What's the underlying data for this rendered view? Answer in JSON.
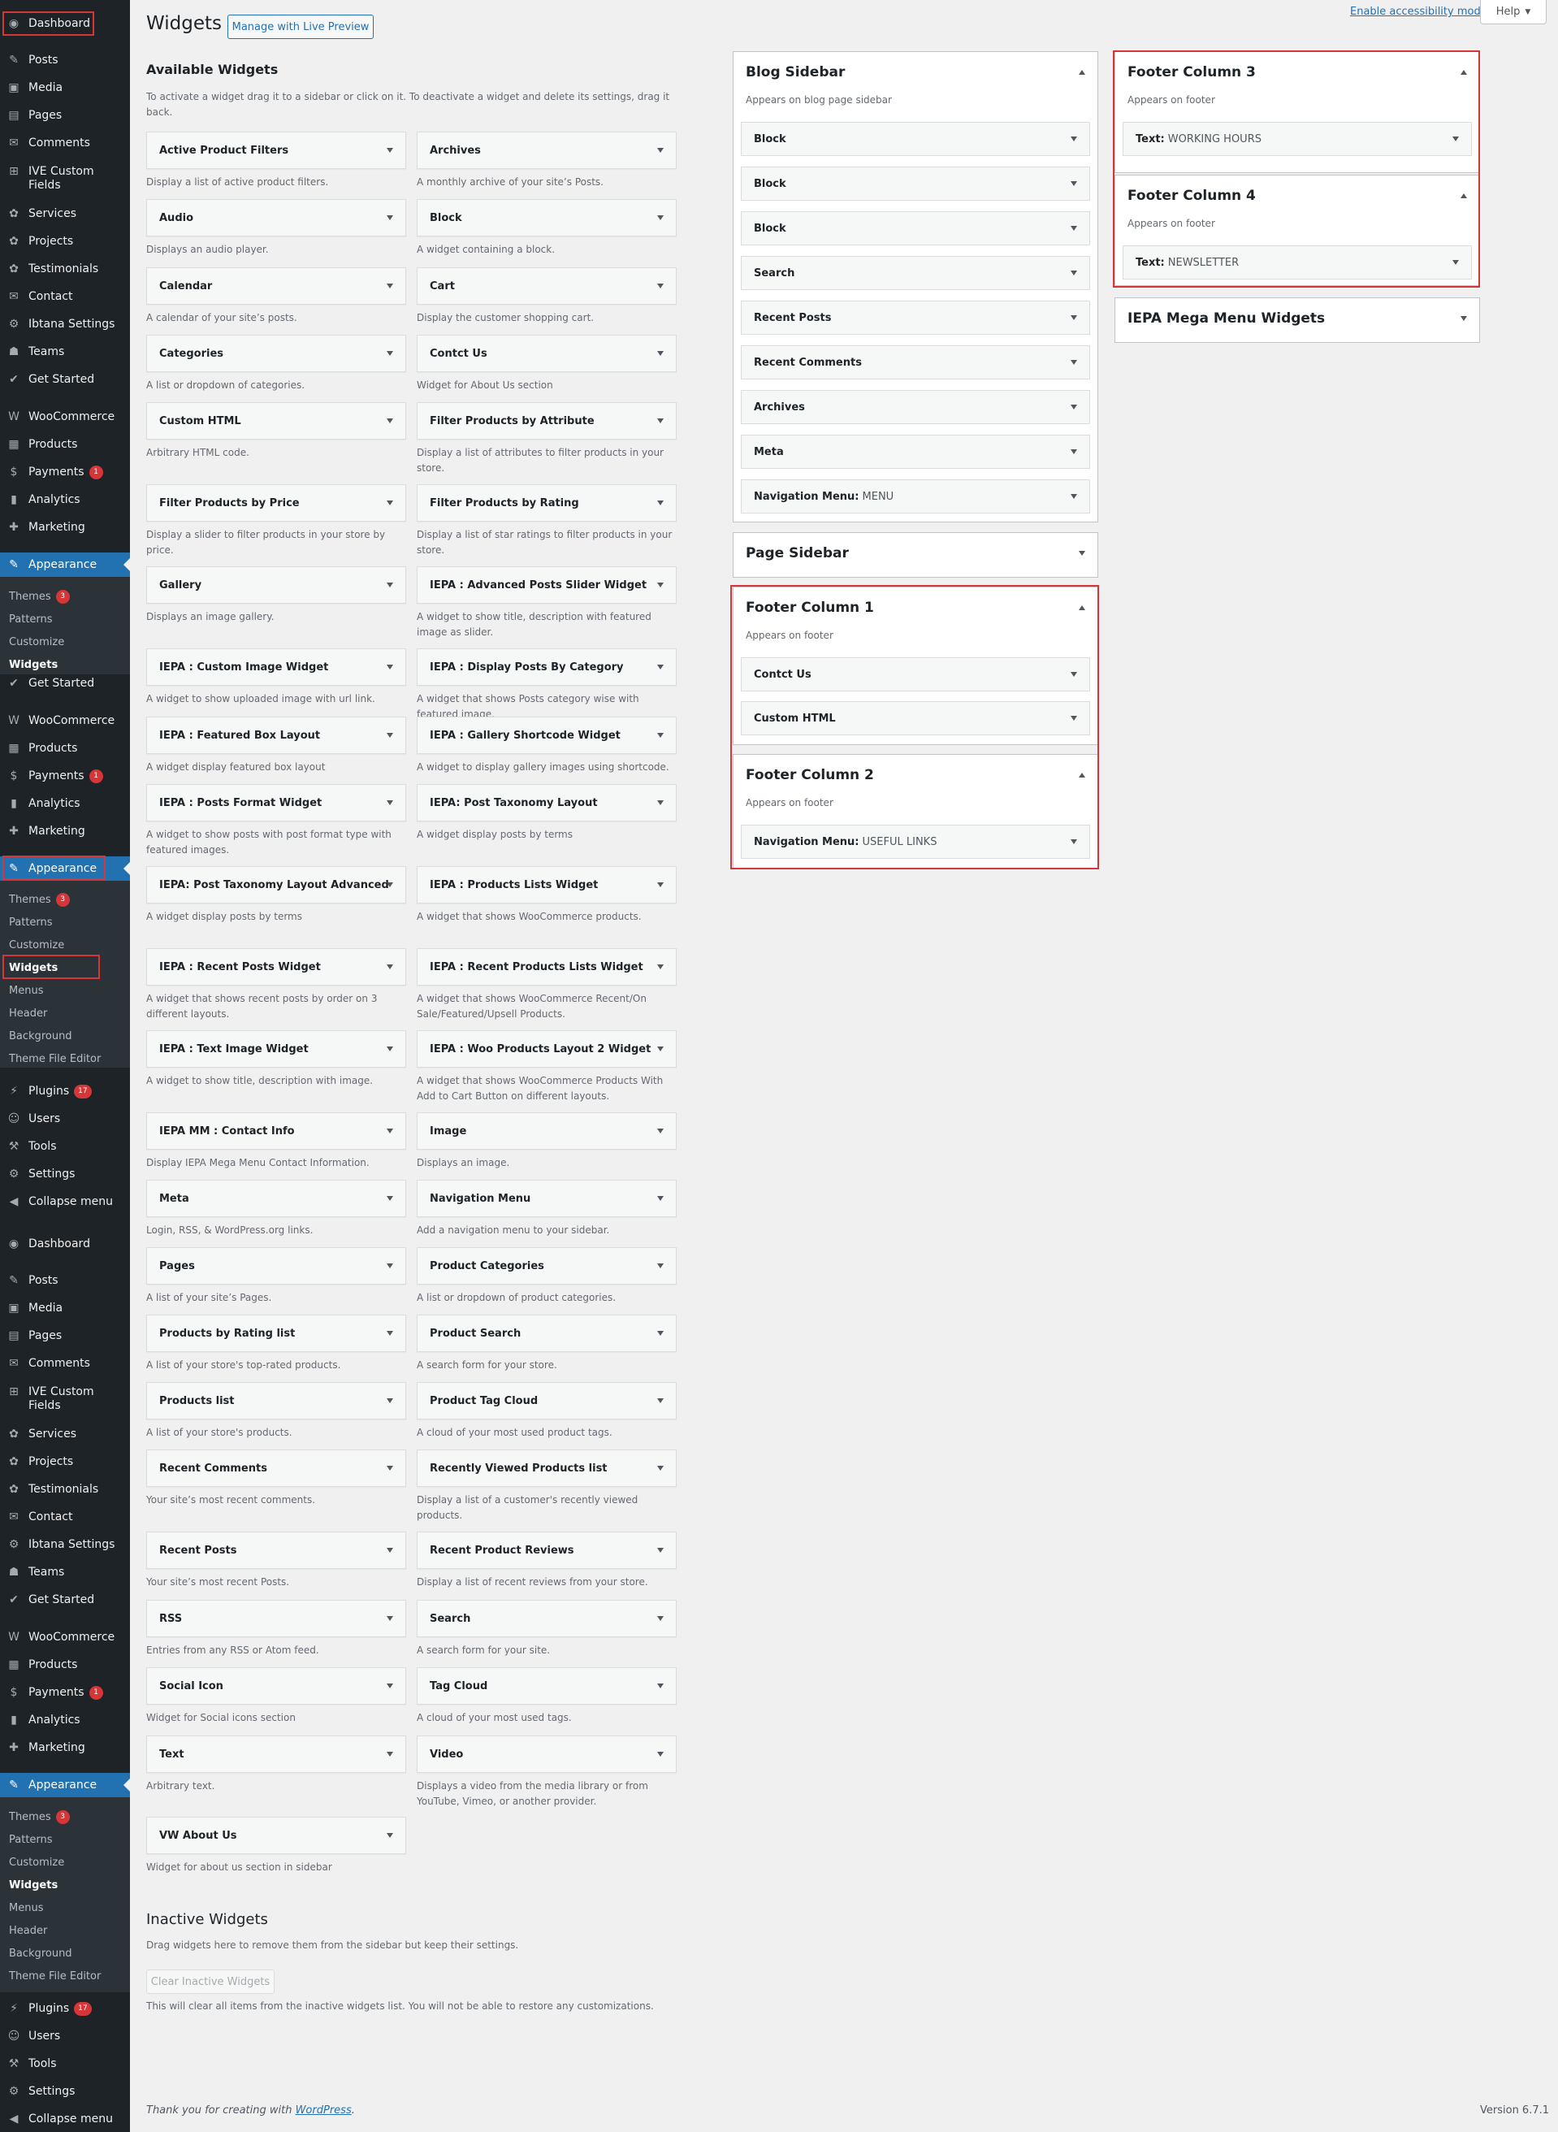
{
  "sidebar_blocks": [
    {
      "items": [
        "Dashboard",
        "Posts",
        "Media",
        "Pages",
        "Comments",
        "IVE Custom Fields",
        "Services",
        "Projects",
        "Testimonials",
        "Contact",
        "Ibtana Settings",
        "Teams",
        "Get Started",
        "WooCommerce",
        "Products",
        "Payments",
        "Analytics",
        "Marketing",
        "Appearance"
      ]
    },
    {
      "items": [
        "WooCommerce",
        "Products",
        "Payments",
        "Analytics",
        "Marketing",
        "Appearance"
      ]
    },
    {
      "items": [
        "Plugins",
        "Users",
        "Tools",
        "Settings",
        "Collapse menu"
      ]
    }
  ],
  "sidebar": {
    "dashboard": "Dashboard",
    "posts": "Posts",
    "media": "Media",
    "pages": "Pages",
    "comments": "Comments",
    "ive_custom_fields": "IVE Custom Fields",
    "services": "Services",
    "projects": "Projects",
    "testimonials": "Testimonials",
    "contact": "Contact",
    "ibtana_settings": "Ibtana Settings",
    "teams": "Teams",
    "get_started": "Get Started",
    "woocommerce": "WooCommerce",
    "products": "Products",
    "payments": "Payments",
    "payments_badge": "1",
    "analytics": "Analytics",
    "marketing": "Marketing",
    "appearance": "Appearance",
    "themes": "Themes",
    "themes_badge": "3",
    "patterns": "Patterns",
    "customize": "Customize",
    "widgets": "Widgets",
    "menus": "Menus",
    "header": "Header",
    "background": "Background",
    "theme_file_editor": "Theme File Editor",
    "plugins": "Plugins",
    "plugins_badge": "17",
    "users": "Users",
    "tools": "Tools",
    "settings": "Settings",
    "collapse_menu": "Collapse menu"
  },
  "header": {
    "title": "Widgets",
    "live_preview": "Manage with Live Preview",
    "accessibility": "Enable accessibility mode",
    "help": "Help"
  },
  "available": {
    "title": "Available Widgets",
    "description": "To activate a widget drag it to a sidebar or click on it. To deactivate a widget and delete its settings, drag it back.",
    "widgets": [
      {
        "name": "Active Product Filters",
        "desc": "Display a list of active product filters."
      },
      {
        "name": "Archives",
        "desc": "A monthly archive of your site’s Posts."
      },
      {
        "name": "Audio",
        "desc": "Displays an audio player."
      },
      {
        "name": "Block",
        "desc": "A widget containing a block."
      },
      {
        "name": "Calendar",
        "desc": "A calendar of your site’s posts."
      },
      {
        "name": "Cart",
        "desc": "Display the customer shopping cart."
      },
      {
        "name": "Categories",
        "desc": "A list or dropdown of categories."
      },
      {
        "name": "Contct Us",
        "desc": "Widget for About Us section"
      },
      {
        "name": "Custom HTML",
        "desc": "Arbitrary HTML code."
      },
      {
        "name": "Filter Products by Attribute",
        "desc": "Display a list of attributes to filter products in your store."
      },
      {
        "name": "Filter Products by Price",
        "desc": "Display a slider to filter products in your store by price."
      },
      {
        "name": "Filter Products by Rating",
        "desc": "Display a list of star ratings to filter products in your store."
      },
      {
        "name": "Gallery",
        "desc": "Displays an image gallery."
      },
      {
        "name": "IEPA : Advanced Posts Slider Widget",
        "desc": "A widget to show title, description with featured image as slider."
      },
      {
        "name": "IEPA : Custom Image Widget",
        "desc": "A widget to show uploaded image with url link."
      },
      {
        "name": "IEPA : Display Posts By Category",
        "desc": "A widget that shows Posts category wise with featured image."
      },
      {
        "name": "IEPA : Featured Box Layout",
        "desc": "A widget display featured box layout"
      },
      {
        "name": "IEPA : Gallery Shortcode Widget",
        "desc": "A widget to display gallery images using shortcode."
      },
      {
        "name": "IEPA : Posts Format Widget",
        "desc": "A widget to show posts with post format type with featured images."
      },
      {
        "name": "IEPA: Post Taxonomy Layout",
        "desc": "A widget display posts by terms"
      },
      {
        "name": "IEPA: Post Taxonomy Layout Advanced",
        "desc": "A widget display posts by terms"
      },
      {
        "name": "IEPA : Products Lists Widget",
        "desc": "A widget that shows WooCommerce products."
      },
      {
        "name": "IEPA : Recent Posts Widget",
        "desc": "A widget that shows recent posts by order on 3 different layouts."
      },
      {
        "name": "IEPA : Recent Products Lists Widget",
        "desc": "A widget that shows WooCommerce Recent/On Sale/Featured/Upsell Products."
      },
      {
        "name": "IEPA : Text Image Widget",
        "desc": "A widget to show title, description with image."
      },
      {
        "name": "IEPA : Woo Products Layout 2 Widget",
        "desc": "A widget that shows WooCommerce Products With Add to Cart Button on different layouts."
      },
      {
        "name": "IEPA MM : Contact Info",
        "desc": "Display IEPA Mega Menu Contact Information."
      },
      {
        "name": "Image",
        "desc": "Displays an image."
      },
      {
        "name": "Meta",
        "desc": "Login, RSS, & WordPress.org links."
      },
      {
        "name": "Navigation Menu",
        "desc": "Add a navigation menu to your sidebar."
      },
      {
        "name": "Pages",
        "desc": "A list of your site’s Pages."
      },
      {
        "name": "Product Categories",
        "desc": "A list or dropdown of product categories."
      },
      {
        "name": "Products by Rating list",
        "desc": "A list of your store's top-rated products."
      },
      {
        "name": "Product Search",
        "desc": "A search form for your store."
      },
      {
        "name": "Products list",
        "desc": "A list of your store's products."
      },
      {
        "name": "Product Tag Cloud",
        "desc": "A cloud of your most used product tags."
      },
      {
        "name": "Recent Comments",
        "desc": "Your site’s most recent comments."
      },
      {
        "name": "Recently Viewed Products list",
        "desc": "Display a list of a customer's recently viewed products."
      },
      {
        "name": "Recent Posts",
        "desc": "Your site’s most recent Posts."
      },
      {
        "name": "Recent Product Reviews",
        "desc": "Display a list of recent reviews from your store."
      },
      {
        "name": "RSS",
        "desc": "Entries from any RSS or Atom feed."
      },
      {
        "name": "Search",
        "desc": "A search form for your site."
      },
      {
        "name": "Social Icon",
        "desc": "Widget for Social icons section"
      },
      {
        "name": "Tag Cloud",
        "desc": "A cloud of your most used tags."
      },
      {
        "name": "Text",
        "desc": "Arbitrary text."
      },
      {
        "name": "Video",
        "desc": "Displays a video from the media library or from YouTube, Vimeo, or another provider."
      },
      {
        "name": "VW About Us",
        "desc": "Widget for about us section in sidebar"
      }
    ]
  },
  "inactive": {
    "title": "Inactive Widgets",
    "description": "Drag widgets here to remove them from the sidebar but keep their settings.",
    "clear_button": "Clear Inactive Widgets",
    "note": "This will clear all items from the inactive widgets list. You will not be able to restore any customizations."
  },
  "sidebars": {
    "blog": {
      "title": "Blog Sidebar",
      "desc": "Appears on blog page sidebar",
      "widgets": [
        {
          "name": "Block",
          "sub": ""
        },
        {
          "name": "Block",
          "sub": ""
        },
        {
          "name": "Block",
          "sub": ""
        },
        {
          "name": "Search",
          "sub": ""
        },
        {
          "name": "Recent Posts",
          "sub": ""
        },
        {
          "name": "Recent Comments",
          "sub": ""
        },
        {
          "name": "Archives",
          "sub": ""
        },
        {
          "name": "Meta",
          "sub": ""
        },
        {
          "name": "Navigation Menu:",
          "sub": "MENU"
        }
      ]
    },
    "page": {
      "title": "Page Sidebar"
    },
    "footer1": {
      "title": "Footer Column 1",
      "desc": "Appears on footer",
      "widgets": [
        {
          "name": "Contct Us",
          "sub": ""
        },
        {
          "name": "Custom HTML",
          "sub": ""
        }
      ]
    },
    "footer2": {
      "title": "Footer Column 2",
      "desc": "Appears on footer",
      "widgets": [
        {
          "name": "Navigation Menu:",
          "sub": "USEFUL LINKS"
        }
      ]
    },
    "footer3": {
      "title": "Footer Column 3",
      "desc": "Appears on footer",
      "widgets": [
        {
          "name": "Text:",
          "sub": "WORKING HOURS"
        }
      ]
    },
    "footer4": {
      "title": "Footer Column 4",
      "desc": "Appears on footer",
      "widgets": [
        {
          "name": "Text:",
          "sub": "NEWSLETTER"
        }
      ]
    },
    "mega": {
      "title": "IEPA Mega Menu Widgets"
    }
  },
  "footer": {
    "credit_prefix": "Thank you for creating with ",
    "credit_link": "WordPress",
    "credit_suffix": ".",
    "version": "Version 6.7.1"
  },
  "colors": {
    "sidebar_bg": "#1d2327",
    "accent": "#2271b1",
    "badge": "#d63638",
    "highlight_box": "#d63638"
  }
}
